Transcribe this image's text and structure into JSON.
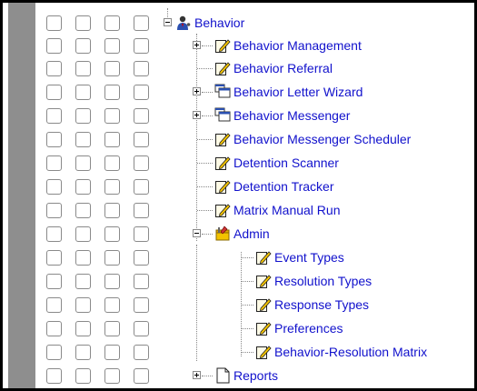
{
  "tree": {
    "root": {
      "label": "Behavior",
      "icon": "user-group-icon",
      "state": "expanded"
    },
    "items": [
      {
        "label": "Behavior Management",
        "icon": "document-edit-icon",
        "state": "collapsed"
      },
      {
        "label": "Behavior Referral",
        "icon": "document-edit-icon",
        "state": "leaf"
      },
      {
        "label": "Behavior Letter Wizard",
        "icon": "windows-icon",
        "state": "collapsed"
      },
      {
        "label": "Behavior Messenger",
        "icon": "windows-icon",
        "state": "collapsed"
      },
      {
        "label": "Behavior Messenger Scheduler",
        "icon": "document-edit-icon",
        "state": "leaf"
      },
      {
        "label": "Detention Scanner",
        "icon": "document-edit-icon",
        "state": "leaf"
      },
      {
        "label": "Detention Tracker",
        "icon": "document-edit-icon",
        "state": "leaf"
      },
      {
        "label": "Matrix Manual Run",
        "icon": "document-edit-icon",
        "state": "leaf"
      },
      {
        "label": "Admin",
        "icon": "admin-tools-icon",
        "state": "expanded"
      }
    ],
    "admin_items": [
      {
        "label": "Event Types",
        "icon": "document-edit-icon"
      },
      {
        "label": "Resolution Types",
        "icon": "document-edit-icon"
      },
      {
        "label": "Response Types",
        "icon": "document-edit-icon"
      },
      {
        "label": "Preferences",
        "icon": "document-edit-icon"
      },
      {
        "label": "Behavior-Resolution Matrix",
        "icon": "document-edit-icon"
      }
    ],
    "reports": {
      "label": "Reports",
      "icon": "document-icon",
      "state": "collapsed"
    }
  },
  "colors": {
    "link": "#1111cc",
    "gutter": "#8e8e8e"
  }
}
